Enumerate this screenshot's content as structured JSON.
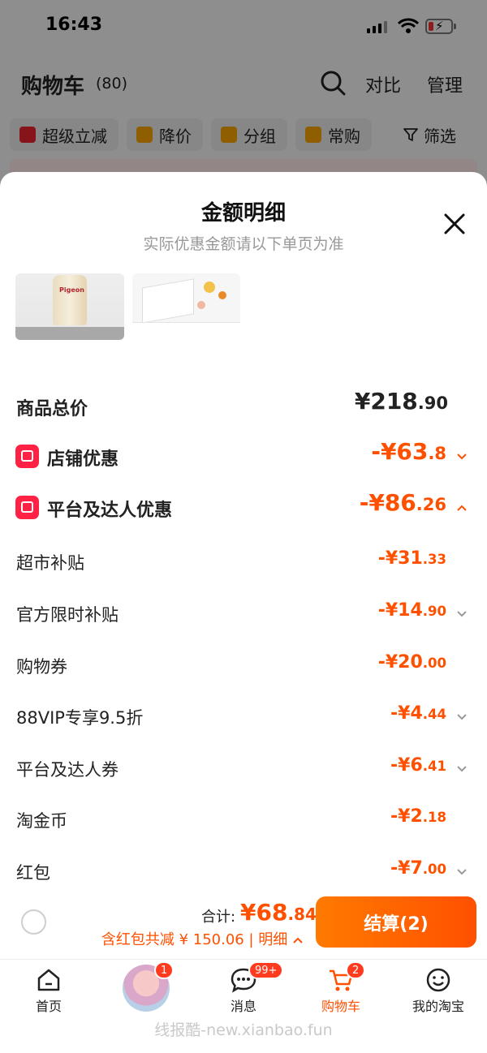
{
  "status": {
    "time": "16:43"
  },
  "cart": {
    "title": "购物车",
    "count": "(80)",
    "compare_label": "对比",
    "manage_label": "管理",
    "filters": [
      {
        "label": "超级立减",
        "icon": "arrow-down-icon",
        "color": "#e8232f"
      },
      {
        "label": "降价",
        "icon": "price-drop-icon",
        "color": "#f5a300"
      },
      {
        "label": "分组",
        "icon": "folder-icon",
        "color": "#f5a300"
      },
      {
        "label": "常购",
        "icon": "bag-icon",
        "color": "#f5a300"
      }
    ],
    "filter_label": "筛选"
  },
  "sheet": {
    "title": "金额明细",
    "subtitle": "实际优惠金额请以下单页为准",
    "total": {
      "label": "商品总价",
      "int": "¥218",
      "dec": ".90"
    },
    "store_discount": {
      "label": "店铺优惠",
      "int": "-¥63",
      "dec": ".8"
    },
    "platform_discount": {
      "label": "平台及达人优惠",
      "int": "-¥86",
      "dec": ".26"
    },
    "items": [
      {
        "label": "超市补贴",
        "int": "-¥31",
        "dec": ".33",
        "chevron": false
      },
      {
        "label": "官方限时补贴",
        "int": "-¥14",
        "dec": ".90",
        "chevron": true
      },
      {
        "label": "购物券",
        "int": "-¥20",
        "dec": ".00",
        "chevron": false
      },
      {
        "label": "88VIP专享9.5折",
        "int": "-¥4",
        "dec": ".44",
        "chevron": true
      },
      {
        "label": "平台及达人券",
        "int": "-¥6",
        "dec": ".41",
        "chevron": true
      },
      {
        "label": "淘金币",
        "int": "-¥2",
        "dec": ".18",
        "chevron": false
      },
      {
        "label": "红包",
        "int": "-¥7",
        "dec": ".00",
        "chevron": true
      }
    ]
  },
  "checkout": {
    "sum_label": "合计:",
    "sum_int": "¥68",
    "sum_dec": ".84",
    "detail": "含红包共减 ¥ 150.06 | 明细",
    "pay_label": "结算(2)"
  },
  "tabs": {
    "home": "首页",
    "avatar_badge": "1",
    "messages": "消息",
    "messages_badge": "99+",
    "cart": "购物车",
    "cart_badge": "2",
    "mine": "我的淘宝"
  },
  "watermark": "线报酷-new.xianbao.fun",
  "colors": {
    "accent": "#ff5000",
    "badge": "#ff2244"
  }
}
